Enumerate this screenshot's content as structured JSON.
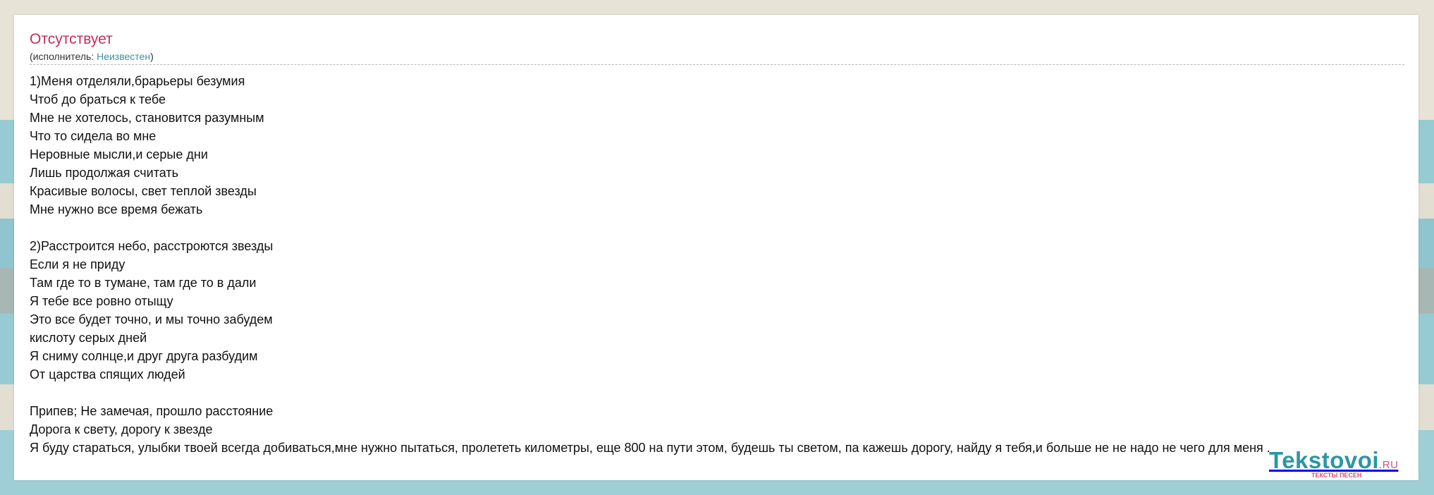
{
  "song": {
    "title": "Отсутствует",
    "artist_prefix": "(исполнитель: ",
    "artist_name": "Неизвестен",
    "artist_suffix": ")"
  },
  "lyrics": {
    "verse1": [
      "1)Меня отделяли,брарьеры безумия",
      "Чтоб до браться к тебе",
      "Мне не хотелось, становится разумным",
      "Что то сидела во мне",
      "Неровные мысли,и серые дни",
      "Лишь продолжая считать",
      "Красивые волосы, свет теплой звезды",
      "Мне нужно все время бежать"
    ],
    "verse2": [
      "2)Расстроится небо, расстроются звезды",
      "Если  я не приду",
      "Там где то в тумане, там где то в дали",
      "Я тебе все ровно отыщу",
      "Это все будет точно, и мы точно забудем",
      "кислоту серых дней",
      "Я сниму солнце,и друг друга разбудим",
      "От царства спящих людей"
    ],
    "chorus": [
      "Припев; Не замечая, прошло расстояние",
      "Дорога к свету, дорогу к звезде",
      "Я буду стараться, улыбки твоей всегда добиваться,мне нужно пытаться, пролететь километры, еще 800 на пути этом, будешь ты светом, па кажешь дорогу, найду я тебя,и больше не не надо не чего для меня ."
    ]
  },
  "logo": {
    "name": "Tekstovoi",
    "tld": ".RU",
    "tagline": "ТЕКСТЫ ПЕСЕН"
  }
}
